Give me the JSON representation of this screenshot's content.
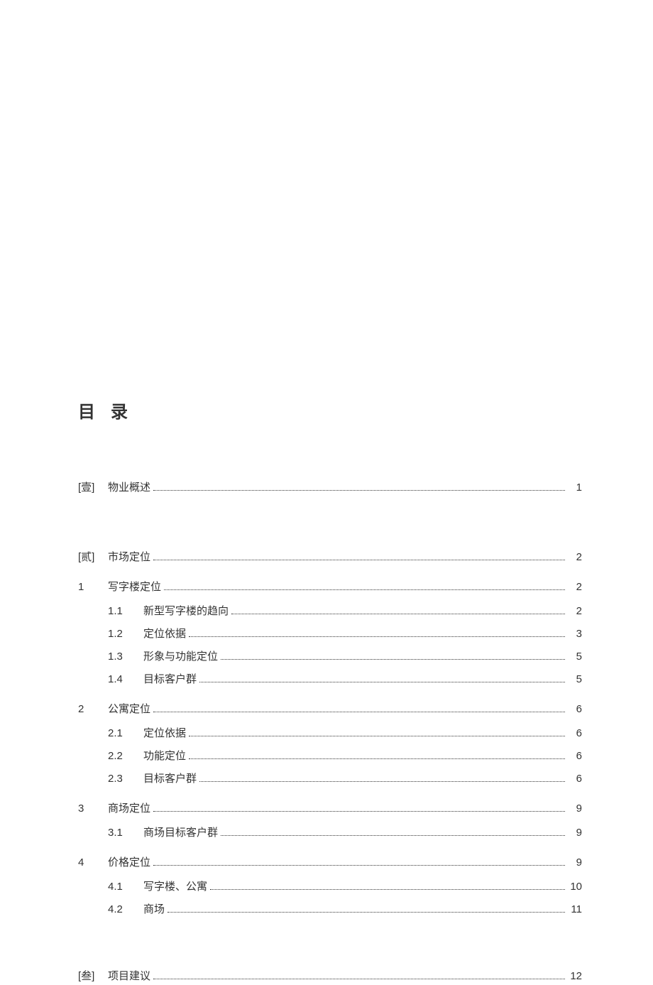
{
  "title": "目 录",
  "entries": [
    {
      "level": 0,
      "marker": "[壹]",
      "sub": "",
      "label": "物业概述",
      "page": "1"
    },
    {
      "level": 0,
      "marker": "[贰]",
      "sub": "",
      "label": "市场定位",
      "page": "2"
    },
    {
      "level": 1,
      "marker": "1",
      "sub": "",
      "label": "写字楼定位",
      "page": "2"
    },
    {
      "level": 2,
      "marker": "",
      "sub": "1.1",
      "label": "新型写字楼的趋向",
      "page": "2"
    },
    {
      "level": 2,
      "marker": "",
      "sub": "1.2",
      "label": "定位依据",
      "page": "3"
    },
    {
      "level": 2,
      "marker": "",
      "sub": "1.3",
      "label": "形象与功能定位",
      "page": "5"
    },
    {
      "level": 2,
      "marker": "",
      "sub": "1.4",
      "label": "目标客户群",
      "page": "5"
    },
    {
      "level": 1,
      "marker": "2",
      "sub": "",
      "label": "公寓定位",
      "page": "6"
    },
    {
      "level": 2,
      "marker": "",
      "sub": "2.1",
      "label": "定位依据",
      "page": "6"
    },
    {
      "level": 2,
      "marker": "",
      "sub": "2.2",
      "label": "功能定位",
      "page": "6"
    },
    {
      "level": 2,
      "marker": "",
      "sub": "2.3",
      "label": "目标客户群",
      "page": "6"
    },
    {
      "level": 1,
      "marker": "3",
      "sub": "",
      "label": "商场定位",
      "page": "9"
    },
    {
      "level": 2,
      "marker": "",
      "sub": "3.1",
      "label": "商场目标客户群",
      "page": "9"
    },
    {
      "level": 1,
      "marker": "4",
      "sub": "",
      "label": "价格定位",
      "page": "9"
    },
    {
      "level": 2,
      "marker": "",
      "sub": "4.1",
      "label": "写字楼、公寓",
      "page": "10"
    },
    {
      "level": 2,
      "marker": "",
      "sub": "4.2",
      "label": "商场",
      "page": "11"
    },
    {
      "level": 0,
      "marker": "[叁]",
      "sub": "",
      "label": "项目建议",
      "page": "12"
    }
  ]
}
